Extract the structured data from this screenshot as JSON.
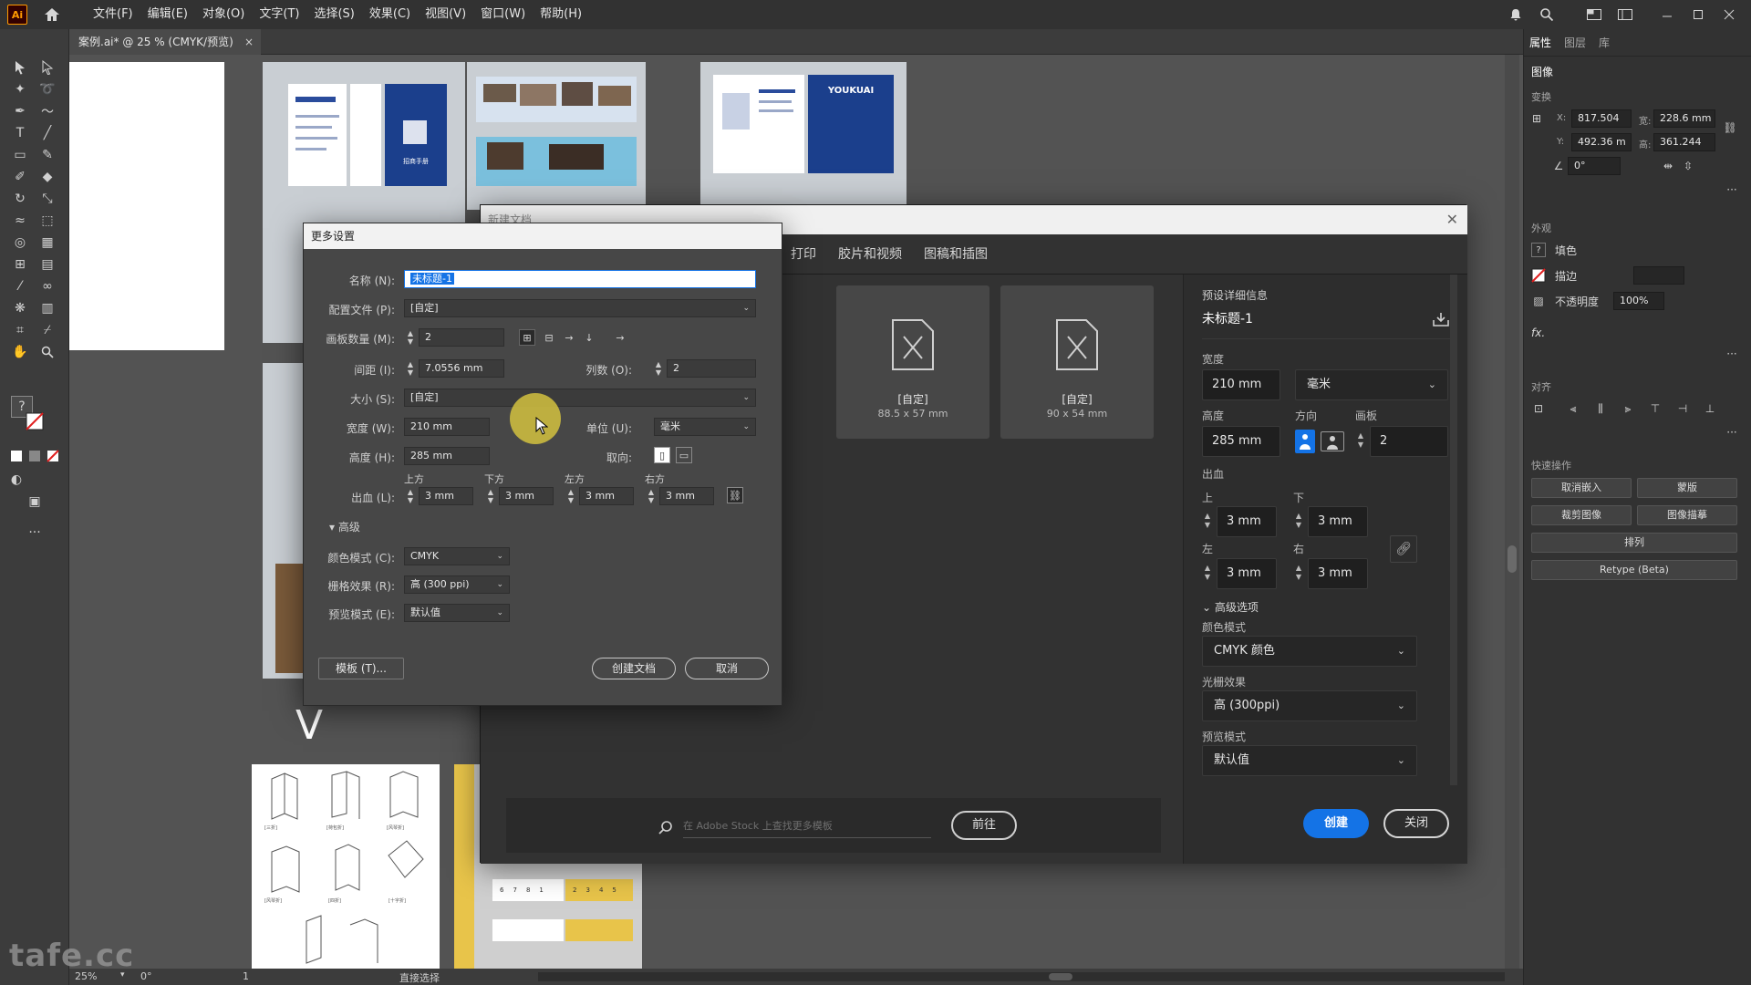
{
  "menubar": {
    "app_logo": "Ai",
    "menus": [
      "文件(F)",
      "编辑(E)",
      "对象(O)",
      "文字(T)",
      "选择(S)",
      "效果(C)",
      "视图(V)",
      "窗口(W)",
      "帮助(H)"
    ]
  },
  "document_tab": {
    "title": "案例.ai* @ 25 % (CMYK/预览)",
    "close": "×"
  },
  "status_bar": {
    "zoom": "25%",
    "rotation": "0°",
    "artboard": "1",
    "tool": "直接选择"
  },
  "watermark": "tafe.cc",
  "canvas": {
    "flyer_titles": [
      "YOUKUAI"
    ],
    "flyer_text_blue": "招商手册",
    "v_mark": "V",
    "fold_captions": [
      "[三折]",
      "[荷包折]",
      "[风琴折]",
      "[风琴折]",
      "[四折]",
      "[十字折]"
    ],
    "table_digits": [
      "6",
      "7",
      "8",
      "1",
      "2",
      "3",
      "4",
      "5"
    ]
  },
  "properties_panel": {
    "tabs": [
      "属性",
      "图层",
      "库"
    ],
    "section_image": "图像",
    "section_transform": "变换",
    "x_label": "X:",
    "x_value": "817.504",
    "y_label": "Y:",
    "y_value": "492.36 m",
    "w_label": "宽:",
    "w_value": "228.6 mm",
    "h_label": "高:",
    "h_value": "361.244",
    "angle": "0°",
    "section_appearance": "外观",
    "fill_label": "填色",
    "stroke_label": "描边",
    "opacity_label": "不透明度",
    "opacity_value": "100%",
    "fx": "fx.",
    "section_align": "对齐",
    "section_quick": "快速操作",
    "quick_buttons": [
      "取消嵌入",
      "蒙版",
      "裁剪图像",
      "图像描摹",
      "排列",
      "Retype (Beta)"
    ]
  },
  "new_document": {
    "title": "新建文档",
    "tabs": [
      "打印",
      "胶片和视频",
      "图稿和插图"
    ],
    "presets": [
      {
        "name": "[自定]",
        "size": "88.5 x 57 mm"
      },
      {
        "name": "[自定]",
        "size": "90 x 54 mm"
      }
    ],
    "search_placeholder": "在 Adobe Stock 上查找更多模板",
    "go_button": "前往",
    "details_heading": "预设详细信息",
    "doc_name": "未标题-1",
    "width_label": "宽度",
    "width_value": "210 mm",
    "unit_value": "毫米",
    "height_label": "高度",
    "height_value": "285 mm",
    "orientation_label": "方向",
    "artboards_label": "画板",
    "artboards_value": "2",
    "bleed_label": "出血",
    "bleed_top_label": "上",
    "bleed_bottom_label": "下",
    "bleed_left_label": "左",
    "bleed_right_label": "右",
    "bleed_top": "3 mm",
    "bleed_bottom": "3 mm",
    "bleed_left": "3 mm",
    "bleed_right": "3 mm",
    "advanced_label": "高级选项",
    "color_mode_label": "颜色模式",
    "color_mode_value": "CMYK 颜色",
    "raster_label": "光栅效果",
    "raster_value": "高 (300ppi)",
    "preview_label": "预览模式",
    "preview_value": "默认值",
    "create_button": "创建",
    "close_button": "关闭"
  },
  "more_settings": {
    "title": "更多设置",
    "name_label": "名称 (N):",
    "name_value": "未标题-1",
    "profile_label": "配置文件 (P):",
    "profile_value": "[自定]",
    "artboards_label": "画板数量 (M):",
    "artboards_value": "2",
    "spacing_label": "间距 (I):",
    "spacing_value": "7.0556 mm",
    "columns_label": "列数 (O):",
    "columns_value": "2",
    "size_label": "大小 (S):",
    "size_value": "[自定]",
    "width_label": "宽度 (W):",
    "width_value": "210 mm",
    "unit_label": "单位 (U):",
    "unit_value": "毫米",
    "height_label": "高度 (H):",
    "height_value": "285 mm",
    "orientation_label": "取向:",
    "bleed_label": "出血 (L):",
    "bleed_top_label": "上方",
    "bleed_bottom_label": "下方",
    "bleed_left_label": "左方",
    "bleed_right_label": "右方",
    "bleed_top": "3 mm",
    "bleed_bottom": "3 mm",
    "bleed_left": "3 mm",
    "bleed_right": "3 mm",
    "advanced_label": "高级",
    "color_mode_label": "颜色模式 (C):",
    "color_mode_value": "CMYK",
    "raster_label": "栅格效果 (R):",
    "raster_value": "高 (300 ppi)",
    "preview_label": "预览模式 (E):",
    "preview_value": "默认值",
    "template_button": "模板 (T)...",
    "create_button": "创建文档",
    "cancel_button": "取消"
  },
  "colors": {
    "accent_blue": "#1473e6",
    "brochure_blue": "#1b3f8c",
    "highlight_yellow": "#e8c44a",
    "cursor_halo": "#d4c240"
  }
}
